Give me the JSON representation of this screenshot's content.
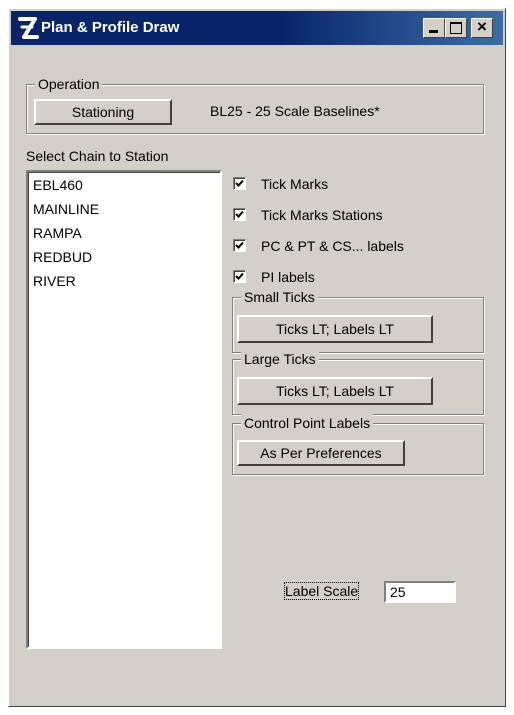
{
  "window": {
    "title": "Plan & Profile Draw"
  },
  "operation": {
    "group_title": "Operation",
    "button_label": "Stationing",
    "baseline_text": "BL25 - 25 Scale Baselines*"
  },
  "chain": {
    "label": "Select Chain to Station",
    "items": [
      "EBL460",
      "MAINLINE",
      "RAMPA",
      "REDBUD",
      "RIVER"
    ]
  },
  "checkboxes": [
    {
      "label": "Tick Marks",
      "checked": true
    },
    {
      "label": "Tick Marks Stations",
      "checked": true
    },
    {
      "label": "PC & PT & CS... labels",
      "checked": true
    },
    {
      "label": "PI labels",
      "checked": true
    }
  ],
  "small_ticks": {
    "title": "Small Ticks",
    "button_label": "Ticks LT; Labels LT"
  },
  "large_ticks": {
    "title": "Large Ticks",
    "button_label": "Ticks LT; Labels LT"
  },
  "control_point_labels": {
    "title": "Control Point Labels",
    "button_label": "As Per Preferences"
  },
  "label_scale": {
    "label": "Label Scale",
    "value": "25"
  },
  "icons": {
    "app": "plan-profile-app-icon",
    "minimize": "minimize-icon",
    "maximize": "maximize-icon",
    "close": "close-icon",
    "check": "check-icon"
  },
  "colors": {
    "titlebar": "#0a246a",
    "face": "#d4d0c8"
  }
}
